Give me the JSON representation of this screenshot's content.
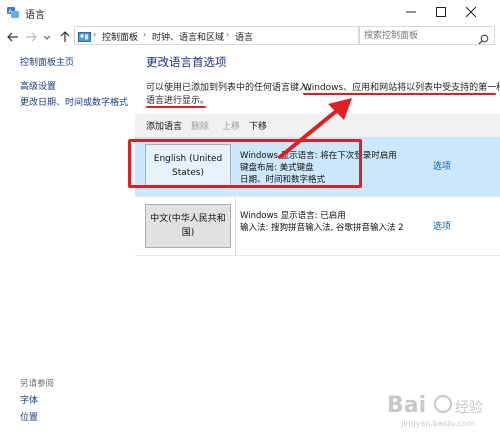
{
  "window": {
    "title": "语言"
  },
  "address": {
    "crumbs": [
      "控制面板",
      "时钟、语言和区域",
      "语言"
    ],
    "search_placeholder": "搜索控制面板"
  },
  "sidebar": {
    "home": "控制面板主页",
    "links": [
      "高级设置",
      "更改日期、时间或数字格式"
    ],
    "see_also_heading": "另请参阅",
    "see_also": [
      "字体",
      "位置"
    ]
  },
  "main": {
    "title": "更改语言首选项",
    "description_line1_a": "可以使用已添加到列表中的任何语言键入。",
    "description_line1_b": "Windows、应用和网站将以列表中受支持的第一种",
    "description_line2": "语言进行显示。",
    "toolbar": {
      "add": "添加语言",
      "remove": "删除",
      "up": "上移",
      "down": "下移"
    },
    "languages": [
      {
        "name": "English (United States)",
        "info": [
          "Windows 显示语言: 将在下次登录时启用",
          "键盘布局: 美式键盘",
          "日期、时间和数字格式"
        ],
        "options": "选项"
      },
      {
        "name": "中文(中华人民共和国)",
        "info": [
          "Windows 显示语言: 已启用",
          "输入法: 搜狗拼音输入法, 谷歌拼音输入法 2"
        ],
        "options": "选项"
      }
    ]
  },
  "watermark": {
    "text": "Baidu 经验",
    "url": "jingyan.baidu.com"
  },
  "colors": {
    "annotation_red": "#e01e24",
    "link_blue": "#0063b1",
    "selected_row": "#cce8ff",
    "title_blue": "#1e3287"
  }
}
